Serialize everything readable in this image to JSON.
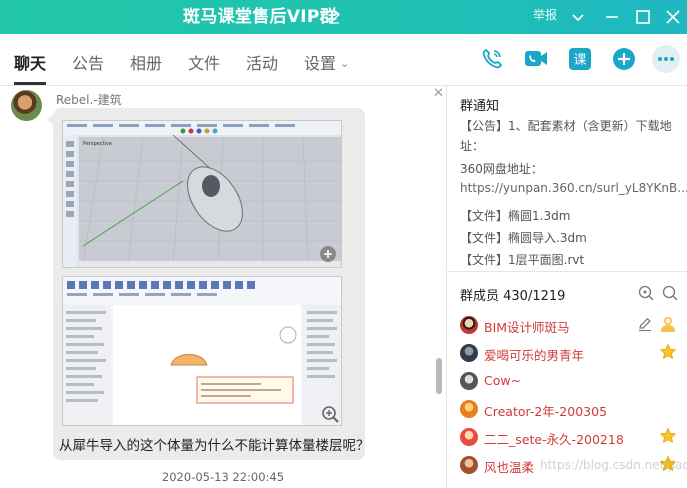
{
  "window": {
    "title": "斑马课堂售后VIP群",
    "report_label": "举报"
  },
  "tabs": [
    {
      "label": "聊天",
      "active": true
    },
    {
      "label": "公告"
    },
    {
      "label": "相册"
    },
    {
      "label": "文件"
    },
    {
      "label": "活动"
    },
    {
      "label": "设置"
    }
  ],
  "header_actions": [
    "phone-icon",
    "video-icon",
    "class-icon",
    "add-icon",
    "more-icon"
  ],
  "chat": {
    "message": {
      "sender": "Rebel.-建筑",
      "text": "从犀牛导入的这个体量为什么不能计算体量楼层呢？",
      "timestamp": "2020-05-13 22:00:45"
    }
  },
  "notice": {
    "title": "群通知",
    "line1": "【公告】1、配套素材（含更新）下载地址：",
    "line2": "360网盘地址：",
    "line3": "https://yunpan.360.cn/surl_yL8YKnB...",
    "files": [
      "【文件】椭圆1.3dm",
      "【文件】椭圆导入.3dm",
      "【文件】1层平面图.rvt"
    ]
  },
  "members": {
    "title": "群成员 430/1219",
    "list": [
      {
        "name": "BIM设计师斑马",
        "color": "#d23a3a",
        "avatar": "#c0392b"
      },
      {
        "name": "爱喝可乐的男青年",
        "color": "#d23a3a",
        "avatar": "#2c3e50"
      },
      {
        "name": "Cow~",
        "color": "#d23a3a",
        "avatar": "#7f8c8d"
      },
      {
        "name": "Creator-2年-200305",
        "color": "#d23a3a",
        "avatar": "#e67e22"
      },
      {
        "name": "二二_sete-永久-200218",
        "color": "#d23a3a",
        "avatar": "#e74c3c"
      },
      {
        "name": "风也温柔",
        "color": "#d23a3a",
        "avatar": "#a0522d"
      }
    ]
  },
  "watermark": "https://blog.csdn.net/jiadian..."
}
